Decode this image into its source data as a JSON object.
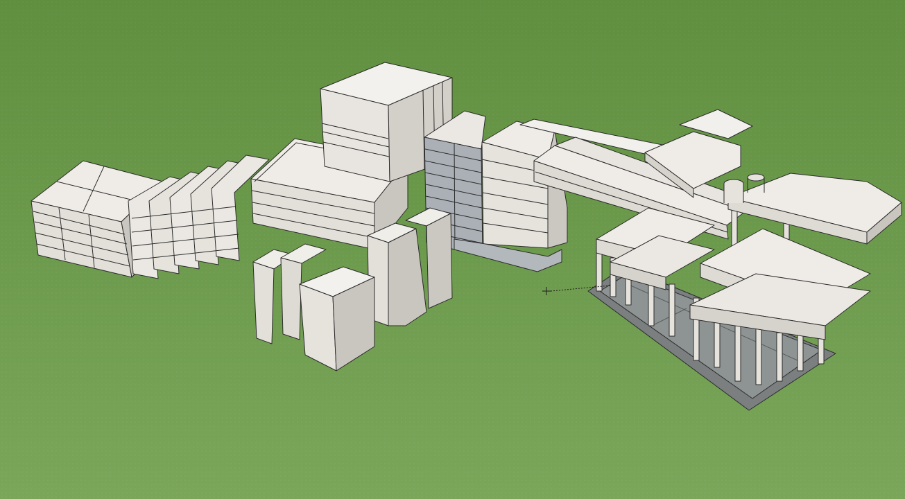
{
  "viewport": {
    "background_top": "#5f8f3f",
    "background_bottom": "#7ca85c",
    "face_light": "#efece7",
    "face_mid": "#dcd8d2",
    "face_dark": "#c4c0ba",
    "glass": "#aab0b6",
    "ground_plate": "#7b7f80",
    "edge_color": "#2b2b2b"
  },
  "cursor": {
    "icon": "crosshair-cursor-icon"
  }
}
